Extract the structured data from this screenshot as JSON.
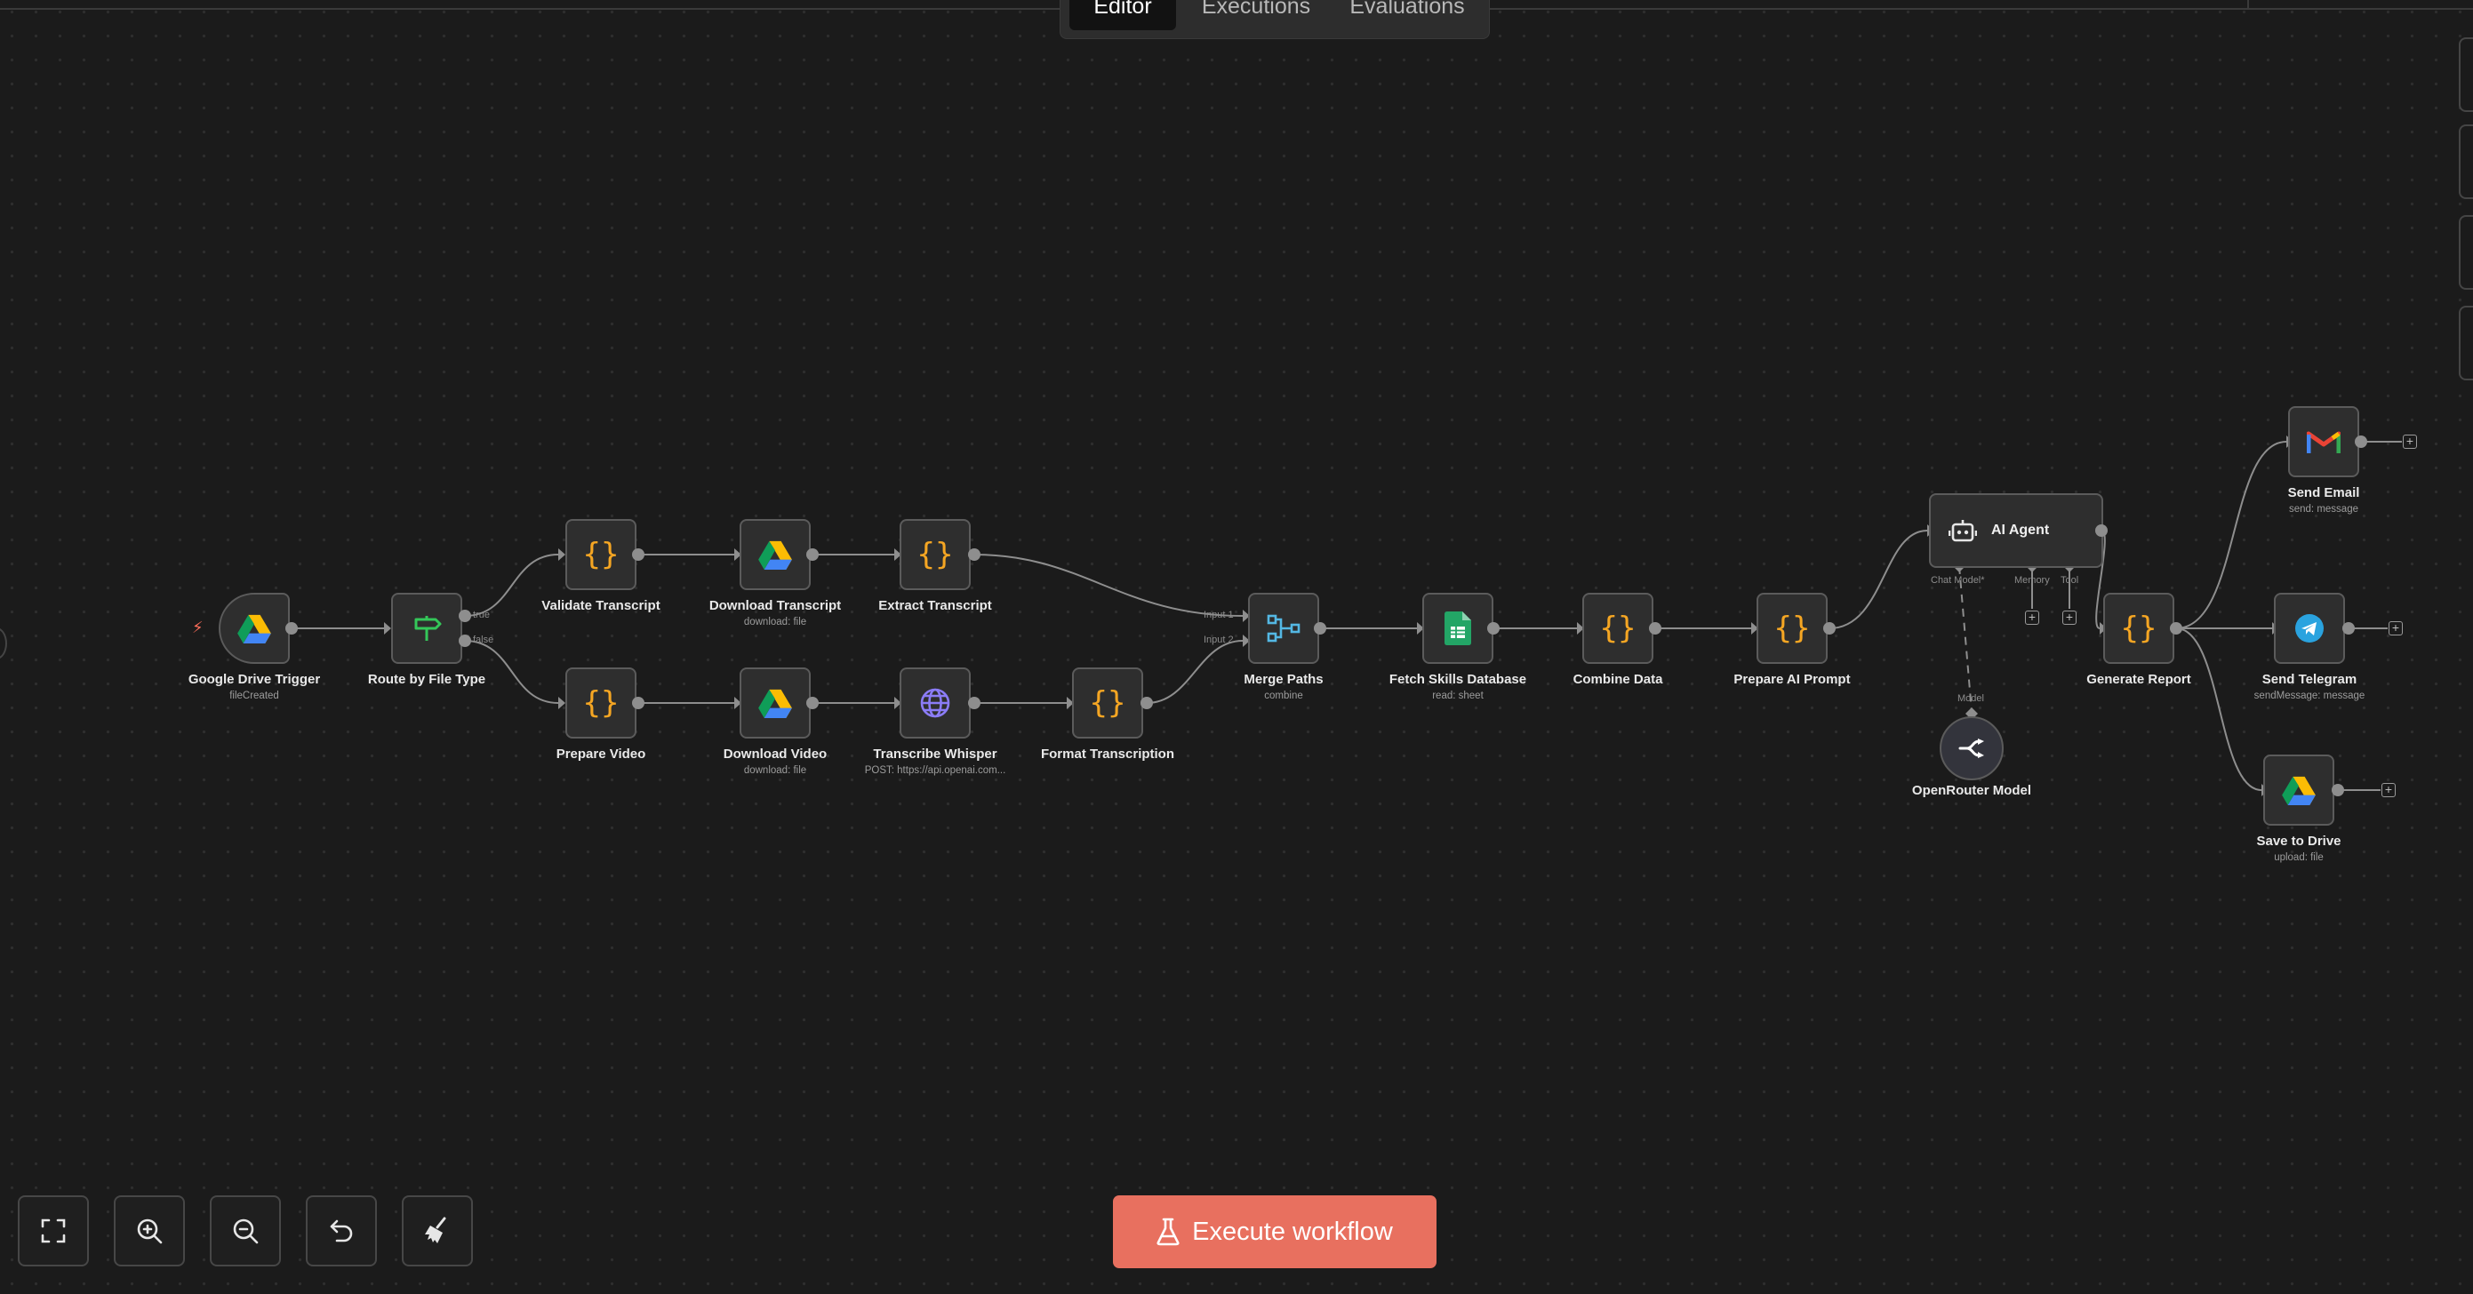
{
  "tabs": [
    {
      "label": "Editor",
      "active": true
    },
    {
      "label": "Executions",
      "active": false
    },
    {
      "label": "Evaluations",
      "active": false
    }
  ],
  "nodes": {
    "trigger": {
      "title": "Google Drive Trigger",
      "subtitle": "fileCreated",
      "icon": "google-drive-icon"
    },
    "route": {
      "title": "Route by File Type",
      "icon": "signpost-icon"
    },
    "validate": {
      "title": "Validate Transcript",
      "icon": "code-braces-icon"
    },
    "download_transcript": {
      "title": "Download Transcript",
      "subtitle": "download: file",
      "icon": "google-drive-icon"
    },
    "extract": {
      "title": "Extract Transcript",
      "icon": "code-braces-icon"
    },
    "prepare_video": {
      "title": "Prepare Video",
      "icon": "code-braces-icon"
    },
    "download_video": {
      "title": "Download Video",
      "subtitle": "download: file",
      "icon": "google-drive-icon"
    },
    "whisper": {
      "title": "Transcribe Whisper",
      "subtitle": "POST: https://api.openai.com...",
      "icon": "globe-icon"
    },
    "format": {
      "title": "Format Transcription",
      "icon": "code-braces-icon"
    },
    "merge": {
      "title": "Merge Paths",
      "subtitle": "combine",
      "icon": "merge-icon"
    },
    "skills": {
      "title": "Fetch Skills Database",
      "subtitle": "read: sheet",
      "icon": "google-sheets-icon"
    },
    "combine": {
      "title": "Combine Data",
      "icon": "code-braces-icon"
    },
    "prompt": {
      "title": "Prepare AI Prompt",
      "icon": "code-braces-icon"
    },
    "agent": {
      "title": "AI Agent",
      "icon": "robot-icon"
    },
    "openrouter": {
      "title": "OpenRouter Model",
      "icon": "openrouter-icon"
    },
    "report": {
      "title": "Generate Report",
      "icon": "code-braces-icon"
    },
    "email": {
      "title": "Send Email",
      "subtitle": "send: message",
      "icon": "gmail-icon"
    },
    "telegram": {
      "title": "Send Telegram",
      "subtitle": "sendMessage: message",
      "icon": "telegram-icon"
    },
    "drive_save": {
      "title": "Save to Drive",
      "subtitle": "upload: file",
      "icon": "google-drive-icon"
    }
  },
  "port_labels": {
    "route_true": "true",
    "route_false": "false",
    "merge_input1": "Input 1",
    "merge_input2": "Input 2",
    "agent_chat_model": "Chat Model*",
    "agent_memory": "Memory",
    "agent_tool": "Tool",
    "openrouter_model": "Model"
  },
  "controls": {
    "fit_view": "fit-view-icon",
    "zoom_in": "zoom-in-icon",
    "zoom_out": "zoom-out-icon",
    "undo": "undo-icon",
    "tidy_up": "broom-icon"
  },
  "execute_button": {
    "label": "Execute workflow",
    "icon": "flask-icon"
  },
  "colors": {
    "accent": "#e8705f",
    "code_icon": "#f5a623",
    "background": "#1b1b1b",
    "node_background": "#2e2e2e"
  }
}
